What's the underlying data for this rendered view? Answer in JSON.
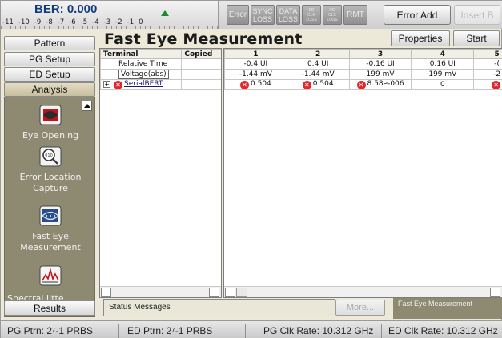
{
  "top": {
    "ber_title": "BER: 0.000",
    "ber_scale": [
      "-11",
      "-10",
      "-9",
      "-8",
      "-7",
      "-6",
      "-5",
      "-4",
      "-3",
      "-2",
      "-1",
      "0"
    ],
    "lights": {
      "error": "Error",
      "sync_loss_1": "SYNC",
      "sync_loss_2": "LOSS",
      "data_loss_1": "DATA",
      "data_loss_2": "LOSS",
      "ed_clk_loss_1": "ED CLK",
      "ed_clk_loss_2": "LOSS",
      "pg_clk_loss_1": "PG CLK",
      "pg_clk_loss_2": "LOSS",
      "rmt": "RMT"
    },
    "error_add": "Error Add",
    "insert_b": "Insert B"
  },
  "nav": {
    "pattern": "Pattern",
    "pg_setup": "PG Setup",
    "ed_setup": "ED Setup",
    "analysis": "Analysis",
    "results": "Results"
  },
  "tools": [
    {
      "label_line1": "Eye Opening",
      "label_line2": ""
    },
    {
      "label_line1": "Error Location",
      "label_line2": "Capture"
    },
    {
      "label_line1": "Fast Eye",
      "label_line2": "Measurement"
    },
    {
      "label_line1": "Spectral Jitte",
      "label_line2": ""
    }
  ],
  "page": {
    "title": "Fast Eye Measurement",
    "properties": "Properties",
    "start": "Start"
  },
  "left_table": {
    "headers": [
      "Terminal",
      "Copied"
    ],
    "rows": [
      "Relative Time",
      "Voltage(abs)",
      "SerialBERT"
    ]
  },
  "right_table": {
    "headers": [
      "1",
      "2",
      "3",
      "4",
      "5"
    ],
    "rows": [
      [
        "-0.4 UI",
        "0.4 UI",
        "-0.16 UI",
        "0.16 UI",
        "-("
      ],
      [
        "-1.44 mV",
        "-1.44 mV",
        "199 mV",
        "199 mV",
        "-2"
      ],
      [
        "0.504",
        "0.504",
        "8.58e-006",
        "0",
        ""
      ]
    ]
  },
  "status": {
    "messages": "Status Messages",
    "more": "More...",
    "right": "Fast Eye Measurement"
  },
  "bottom": {
    "pg_ptrn": "PG Ptrn: 2⁷-1 PRBS",
    "ed_ptrn": "ED Ptrn: 2⁷-1 PRBS",
    "pg_clk": "PG Clk Rate: 10.312 GHz",
    "ed_clk": "ED Clk Rate: 10.312 GHz"
  },
  "colors": {
    "accent_blue": "#133d7a",
    "panel_olive": "#8e8a72",
    "error_red": "#e3262c",
    "ber_green": "#1a8c2b"
  },
  "icons": [
    "eye-opening-icon",
    "magnifier-icon",
    "eye-diagram-icon",
    "jitter-spectrum-icon",
    "error-x-icon"
  ]
}
